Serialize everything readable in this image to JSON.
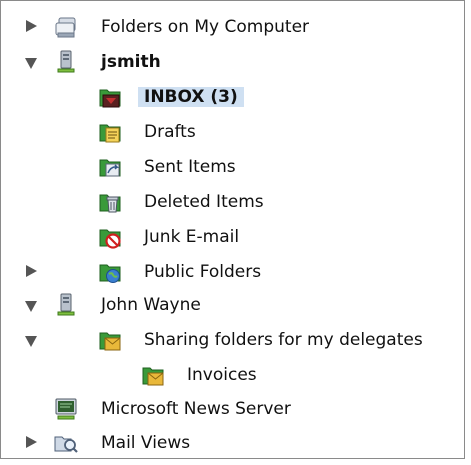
{
  "tree": {
    "items": [
      {
        "label": "Folders on My Computer",
        "icon": "folders-icon",
        "expand": "collapsed"
      },
      {
        "label": "jsmith",
        "icon": "server-account-icon",
        "expand": "expanded"
      },
      {
        "label": "INBOX (3)",
        "icon": "inbox-folder-icon",
        "expand": "none"
      },
      {
        "label": "Drafts",
        "icon": "drafts-folder-icon",
        "expand": "none"
      },
      {
        "label": "Sent Items",
        "icon": "sent-items-folder-icon",
        "expand": "none"
      },
      {
        "label": "Deleted Items",
        "icon": "deleted-items-folder-icon",
        "expand": "none"
      },
      {
        "label": "Junk E-mail",
        "icon": "junk-email-folder-icon",
        "expand": "none"
      },
      {
        "label": "Public Folders",
        "icon": "public-folders-icon",
        "expand": "collapsed"
      },
      {
        "label": "John Wayne",
        "icon": "server-account-icon",
        "expand": "expanded"
      },
      {
        "label": "Sharing folders for my delegates",
        "icon": "shared-folder-icon",
        "expand": "expanded"
      },
      {
        "label": "Invoices",
        "icon": "shared-folder-icon",
        "expand": "none"
      },
      {
        "label": "Microsoft News Server",
        "icon": "news-server-icon",
        "expand": "none"
      },
      {
        "label": "Mail Views",
        "icon": "mail-views-icon",
        "expand": "collapsed"
      }
    ],
    "selected_index": 2,
    "colors": {
      "selection": "#cfe0f2",
      "folder_green": "#3a9a3a",
      "folder_yellow": "#e9b83a",
      "server_green": "#7fbf3f"
    }
  }
}
